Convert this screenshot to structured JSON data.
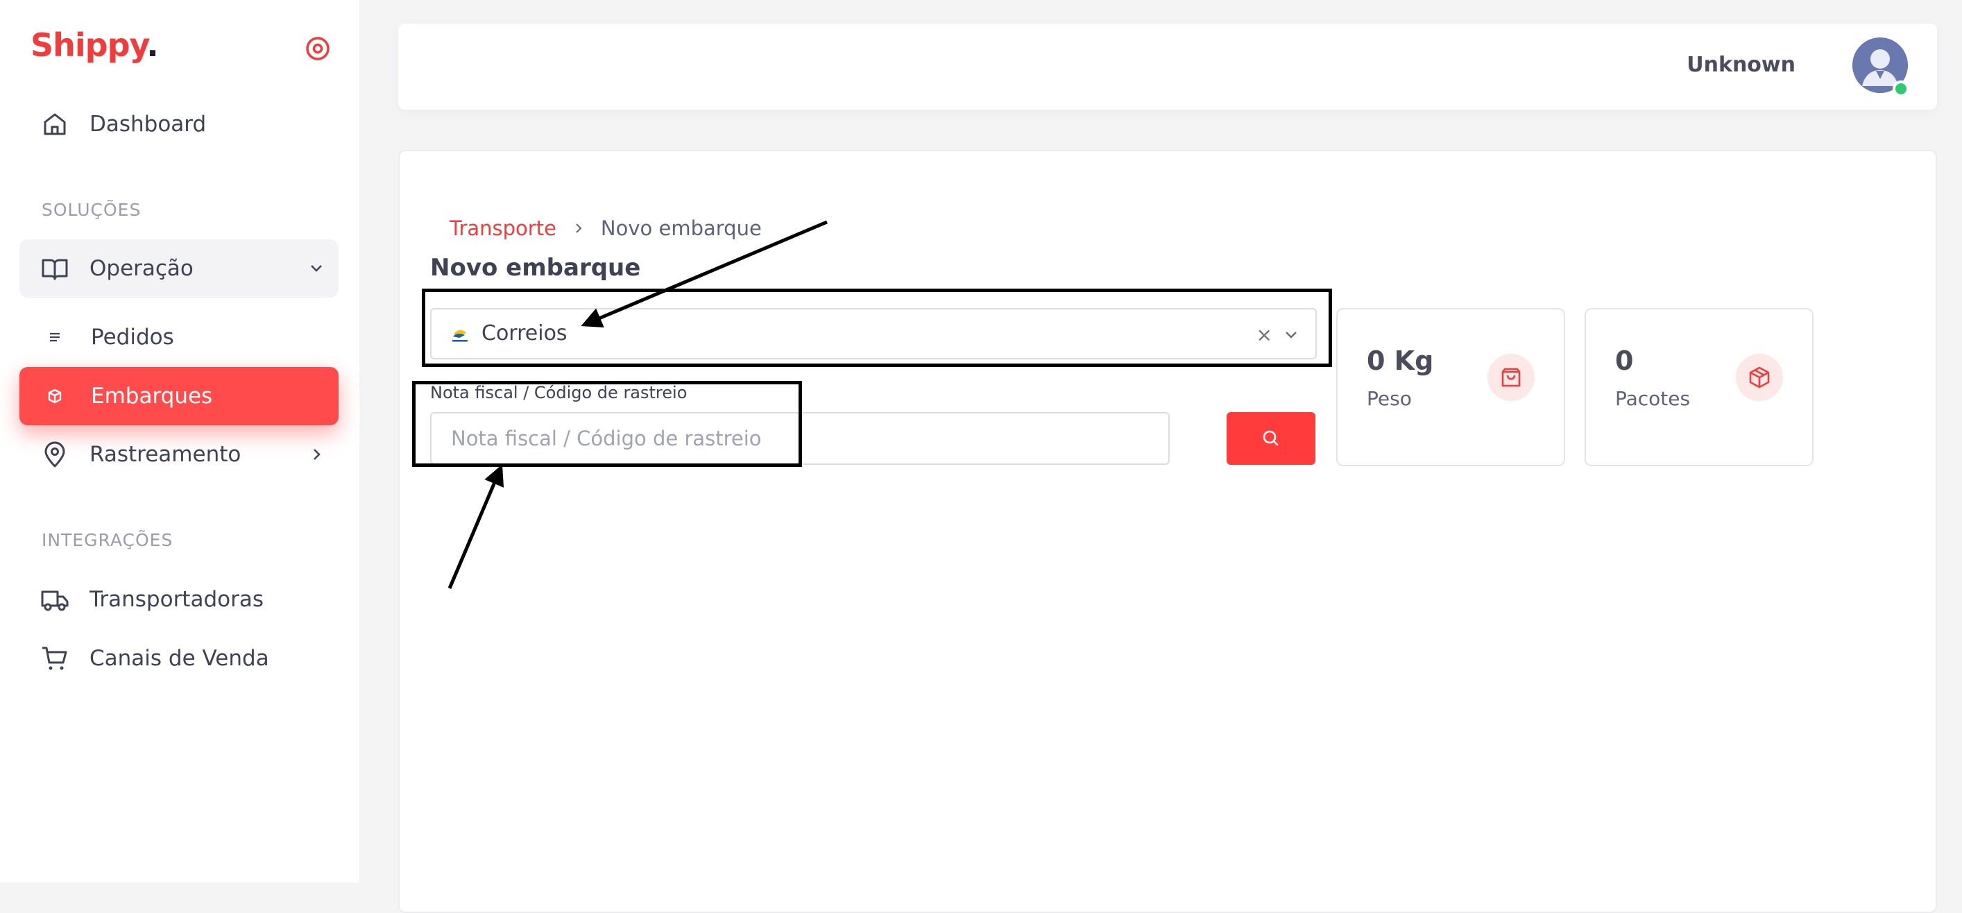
{
  "brand": {
    "name": "Shippy",
    "dot": ".",
    "color": "#f03c3c"
  },
  "sidebar": {
    "items": [
      {
        "label": "Dashboard",
        "icon": "home-icon"
      },
      {
        "label": "Operação",
        "icon": "book-open-icon"
      },
      {
        "label": "Pedidos",
        "icon": "list-icon"
      },
      {
        "label": "Embarques",
        "icon": "box-icon"
      },
      {
        "label": "Rastreamento",
        "icon": "map-pin-icon"
      },
      {
        "label": "Transportadoras",
        "icon": "truck-icon"
      },
      {
        "label": "Canais de Venda",
        "icon": "shopping-cart-icon"
      }
    ],
    "sections": {
      "solutions": "SOLUÇÕES",
      "integrations": "INTEGRAÇÕES"
    }
  },
  "header": {
    "username": "Unknown"
  },
  "main": {
    "breadcrumb": {
      "parent": "Transporte",
      "current": "Novo embarque"
    },
    "title": "Novo embarque",
    "carrier_select": {
      "value": "Correios",
      "clear": "×"
    },
    "tracking": {
      "label": "Nota fiscal / Código de rastreio",
      "placeholder": "Nota fiscal / Código de rastreio",
      "value": ""
    },
    "stats": {
      "weight": {
        "value": "0 Kg",
        "label": "Peso",
        "icon": "shopping-bag-icon"
      },
      "packages": {
        "value": "0",
        "label": "Pacotes",
        "icon": "package-icon"
      }
    }
  },
  "colors": {
    "accent": "#f03c3c",
    "active_bg": "#ff4b4b",
    "online": "#2ecc71"
  }
}
